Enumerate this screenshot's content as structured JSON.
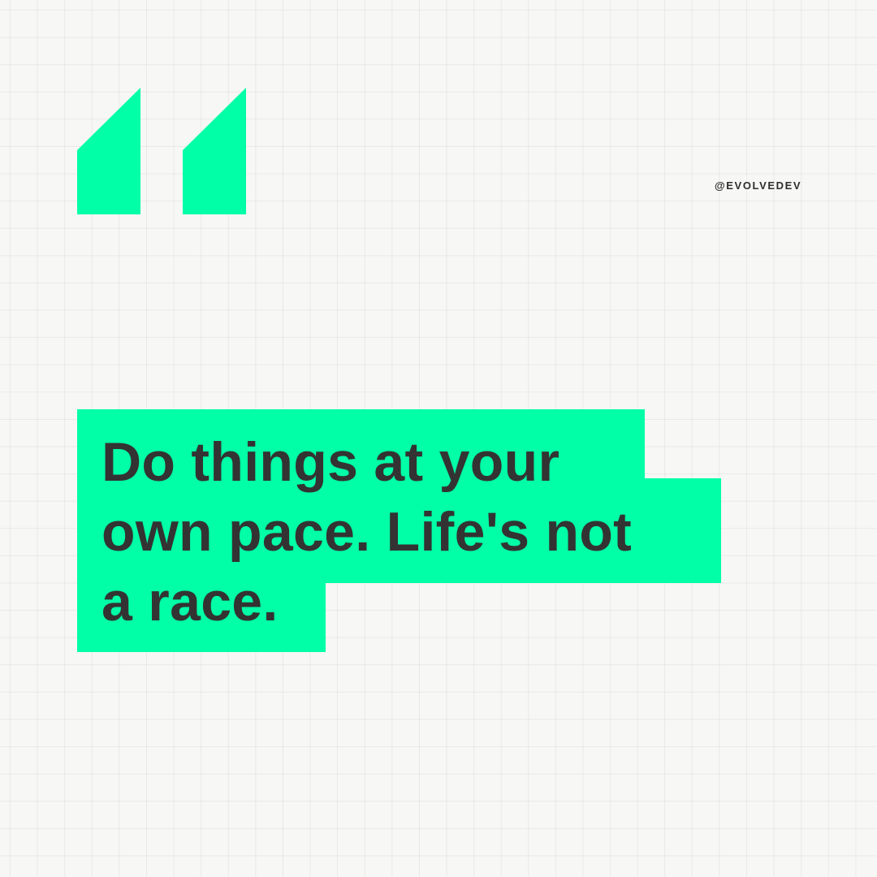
{
  "handle": "@EVOLVEDEV",
  "quote": {
    "lines": [
      "Do things at your",
      "own pace. Life's not",
      "a race."
    ]
  },
  "colors": {
    "accent": "#00ffa6",
    "text": "#333333",
    "background": "#f7f7f5"
  },
  "icons": {
    "quote_mark": "opening-quote-icon"
  }
}
